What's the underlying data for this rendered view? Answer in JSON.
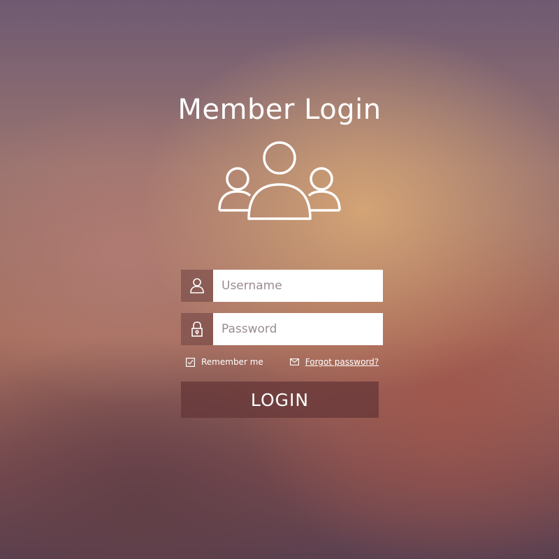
{
  "title": "Member Login",
  "icons": {
    "header": "users-group-icon",
    "username": "user-icon",
    "password": "lock-icon",
    "remember": "checkbox-checked-icon",
    "forgot": "envelope-icon"
  },
  "form": {
    "username_placeholder": "Username",
    "username_value": "",
    "password_placeholder": "Password",
    "password_value": "",
    "remember_label": "Remember me",
    "remember_checked": true,
    "forgot_label": "Forgot password?",
    "submit_label": "LOGIN"
  },
  "colors": {
    "text": "#ffffff",
    "button_bg": "#643436",
    "field_bg": "#ffffff"
  }
}
